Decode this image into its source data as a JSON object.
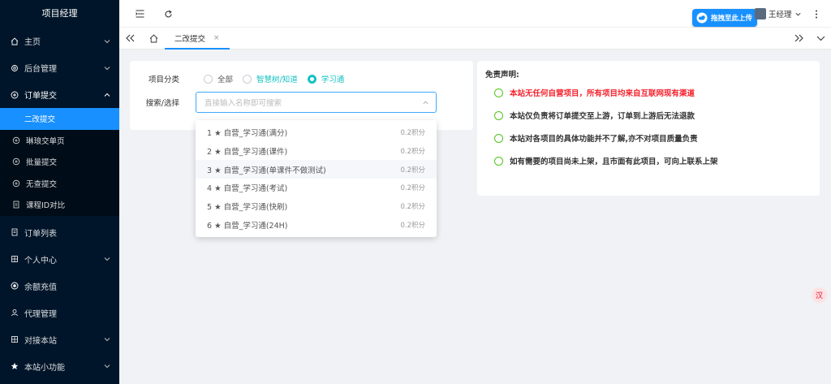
{
  "sidebar": {
    "title": "项目经理",
    "items": [
      {
        "label": "主页",
        "icon": "home-icon",
        "chevron": "down"
      },
      {
        "label": "后台管理",
        "icon": "gear-icon",
        "chevron": "down"
      },
      {
        "label": "订单提交",
        "icon": "plus-circle-icon",
        "chevron": "up"
      }
    ],
    "sub_items": [
      {
        "label": "二改提交",
        "active": true
      },
      {
        "label": "琳琅交单页",
        "icon": "plus-circle-icon"
      },
      {
        "label": "批量提交",
        "icon": "plus-circle-icon"
      },
      {
        "label": "无查提交",
        "icon": "plus-circle-icon"
      },
      {
        "label": "课程ID对比",
        "icon": "doc-icon"
      }
    ],
    "items_bottom": [
      {
        "label": "订单列表",
        "icon": "list-icon"
      },
      {
        "label": "个人中心",
        "icon": "user-grid-icon",
        "chevron": "down"
      },
      {
        "label": "余额充值",
        "icon": "coin-icon"
      },
      {
        "label": "代理管理",
        "icon": "agent-icon"
      },
      {
        "label": "对接本站",
        "icon": "link-icon",
        "chevron": "down"
      },
      {
        "label": "本站小功能",
        "icon": "star-icon",
        "chevron": "down"
      }
    ]
  },
  "header": {
    "upload_label": "拖拽至此上传",
    "user_name": "王经理"
  },
  "tabs": {
    "active_label": "二改提交",
    "close_glyph": "×"
  },
  "form": {
    "category_label": "项目分类",
    "options": [
      "全部",
      "智慧树/知道",
      "学习通"
    ],
    "selected": "学习通",
    "search_label": "搜索/选择",
    "search_placeholder": "直接输入名称即可搜索"
  },
  "dropdown_items": [
    {
      "label": "1 ★ 自营_学习通(满分)",
      "price": "0.2积分"
    },
    {
      "label": "2 ★ 自营_学习通(课件)",
      "price": "0.2积分"
    },
    {
      "label": "3 ★ 自营_学习通(单课件不做测试)",
      "price": "0.2积分"
    },
    {
      "label": "4 ★ 自营_学习通(考试)",
      "price": "0.2积分"
    },
    {
      "label": "5 ★ 自营_学习通(快刷)",
      "price": "0.2积分"
    },
    {
      "label": "6 ★ 自营_学习通(24H)",
      "price": "0.2积分"
    }
  ],
  "disclaimer": {
    "title": "免责声明:",
    "items": [
      {
        "text": "本站无任何自营项目，所有项目均来自互联网现有渠道",
        "red": true
      },
      {
        "text": "本站仅负责将订单提交至上游，订单到上游后无法退款",
        "red": false
      },
      {
        "text": "本站对各项目的具体功能并不了解,亦不对项目质量负责",
        "red": false
      },
      {
        "text": "如有需要的项目尚未上架，且市面有此项目，可向上联系上架",
        "red": false
      }
    ]
  },
  "float_button": {
    "label": "汉"
  },
  "colors": {
    "sidebar_bg": "#001529",
    "accent": "#1890ff",
    "radio": "#13c2c2",
    "danger": "#f5222d",
    "ok": "#52c41a"
  }
}
